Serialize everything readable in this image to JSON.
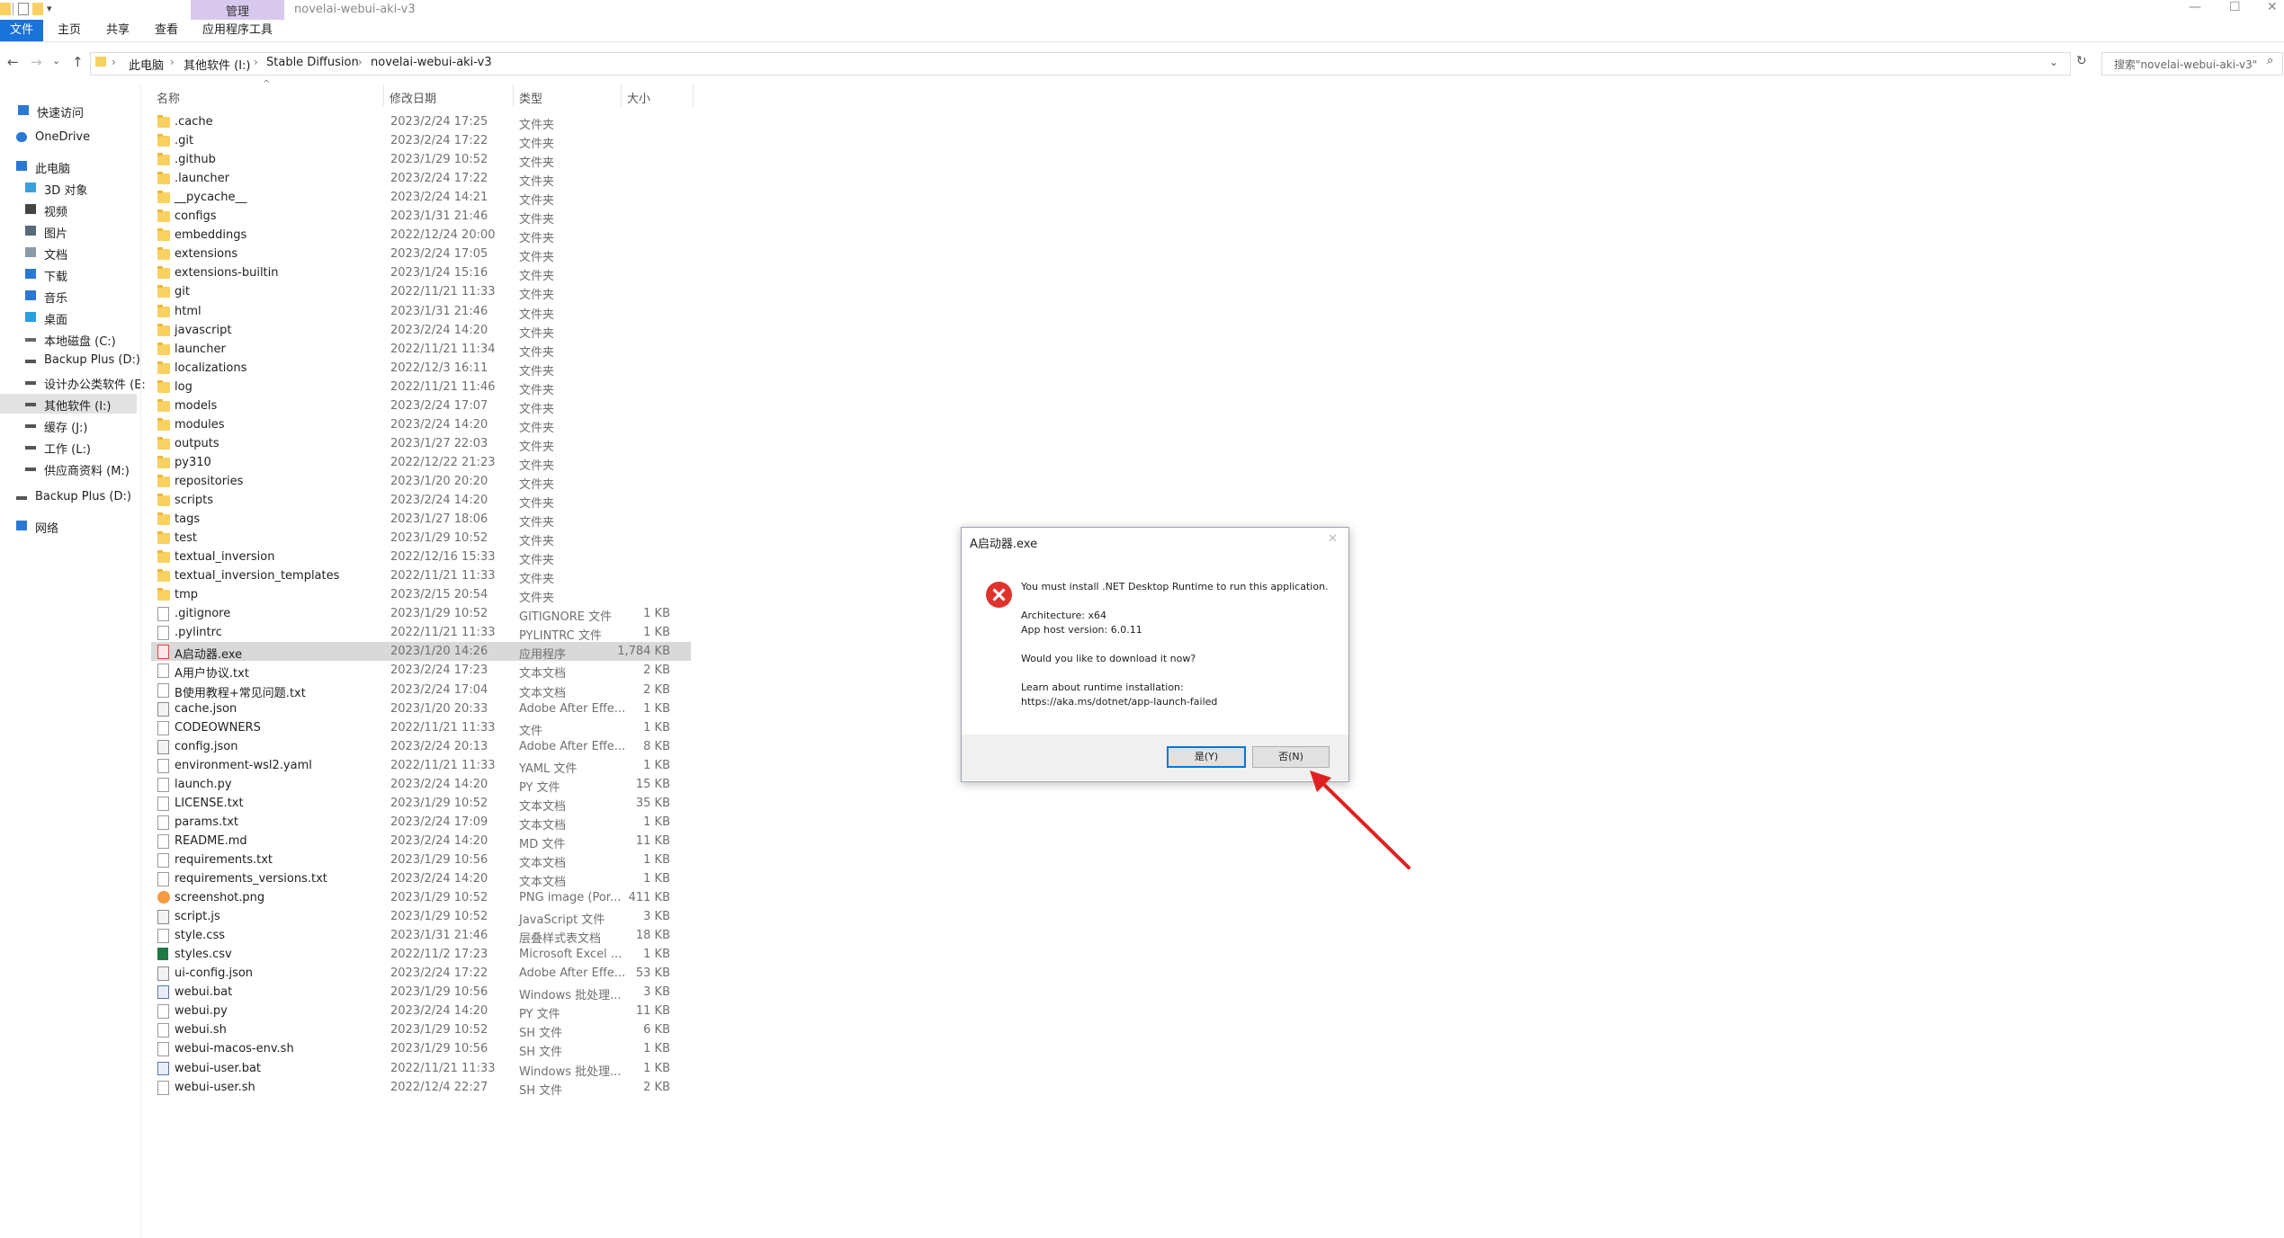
{
  "title_bar": {
    "manage_tab": "管理",
    "window_title": "novelai-webui-aki-v3",
    "minimize": "—",
    "maximize": "☐",
    "close": "✕"
  },
  "ribbon": {
    "tabs": [
      "文件",
      "主页",
      "共享",
      "查看",
      "应用程序工具"
    ]
  },
  "address": {
    "crumbs": [
      "此电脑",
      "其他软件 (I:)",
      "Stable Diffusion",
      "novelai-webui-aki-v3"
    ],
    "search_placeholder": "搜索\"novelai-webui-aki-v3\""
  },
  "sidebar": {
    "items": [
      {
        "label": "快速访问",
        "icon": "star-icon",
        "color": "#2b78d4"
      },
      {
        "label": "OneDrive",
        "icon": "cloud-icon",
        "color": "#2b78d4"
      },
      {
        "label": "此电脑",
        "icon": "computer-icon",
        "color": "#2b78d4"
      },
      {
        "label": "3D 对象",
        "icon": "cube-icon",
        "color": "#3aa0e0"
      },
      {
        "label": "视频",
        "icon": "video-icon",
        "color": "#444444"
      },
      {
        "label": "图片",
        "icon": "picture-icon",
        "color": "#5a6a7a"
      },
      {
        "label": "文档",
        "icon": "document-icon",
        "color": "#8a9aa8"
      },
      {
        "label": "下载",
        "icon": "download-icon",
        "color": "#2b78d4"
      },
      {
        "label": "音乐",
        "icon": "music-icon",
        "color": "#2b78d4"
      },
      {
        "label": "桌面",
        "icon": "desktop-icon",
        "color": "#2b9ee0"
      },
      {
        "label": "本地磁盘 (C:)",
        "icon": "drive-icon",
        "color": "#666666"
      },
      {
        "label": "Backup Plus (D:)",
        "icon": "drive-icon",
        "color": "#555555"
      },
      {
        "label": "设计办公类软件 (E:",
        "icon": "drive-icon",
        "color": "#555555"
      },
      {
        "label": "其他软件 (I:)",
        "icon": "drive-icon",
        "color": "#555555"
      },
      {
        "label": "缓存 (J:)",
        "icon": "drive-icon",
        "color": "#555555"
      },
      {
        "label": "工作 (L:)",
        "icon": "drive-icon",
        "color": "#555555"
      },
      {
        "label": "供应商资料 (M:)",
        "icon": "drive-icon",
        "color": "#555555"
      },
      {
        "label": "Backup Plus (D:)",
        "icon": "drive-icon",
        "color": "#555555"
      },
      {
        "label": "网络",
        "icon": "network-icon",
        "color": "#2b78d4"
      }
    ]
  },
  "columns": [
    "名称",
    "修改日期",
    "类型",
    "大小"
  ],
  "files": [
    {
      "name": ".cache",
      "date": "2023/2/24 17:25",
      "type": "文件夹",
      "size": "",
      "icon": "folder"
    },
    {
      "name": ".git",
      "date": "2023/2/24 17:22",
      "type": "文件夹",
      "size": "",
      "icon": "folder"
    },
    {
      "name": ".github",
      "date": "2023/1/29 10:52",
      "type": "文件夹",
      "size": "",
      "icon": "folder"
    },
    {
      "name": ".launcher",
      "date": "2023/2/24 17:22",
      "type": "文件夹",
      "size": "",
      "icon": "folder"
    },
    {
      "name": "__pycache__",
      "date": "2023/2/24 14:21",
      "type": "文件夹",
      "size": "",
      "icon": "folder"
    },
    {
      "name": "configs",
      "date": "2023/1/31 21:46",
      "type": "文件夹",
      "size": "",
      "icon": "folder"
    },
    {
      "name": "embeddings",
      "date": "2022/12/24 20:00",
      "type": "文件夹",
      "size": "",
      "icon": "folder"
    },
    {
      "name": "extensions",
      "date": "2023/2/24 17:05",
      "type": "文件夹",
      "size": "",
      "icon": "folder"
    },
    {
      "name": "extensions-builtin",
      "date": "2023/1/24 15:16",
      "type": "文件夹",
      "size": "",
      "icon": "folder"
    },
    {
      "name": "git",
      "date": "2022/11/21 11:33",
      "type": "文件夹",
      "size": "",
      "icon": "folder"
    },
    {
      "name": "html",
      "date": "2023/1/31 21:46",
      "type": "文件夹",
      "size": "",
      "icon": "folder"
    },
    {
      "name": "javascript",
      "date": "2023/2/24 14:20",
      "type": "文件夹",
      "size": "",
      "icon": "folder"
    },
    {
      "name": "launcher",
      "date": "2022/11/21 11:34",
      "type": "文件夹",
      "size": "",
      "icon": "folder"
    },
    {
      "name": "localizations",
      "date": "2022/12/3 16:11",
      "type": "文件夹",
      "size": "",
      "icon": "folder"
    },
    {
      "name": "log",
      "date": "2022/11/21 11:46",
      "type": "文件夹",
      "size": "",
      "icon": "folder"
    },
    {
      "name": "models",
      "date": "2023/2/24 17:07",
      "type": "文件夹",
      "size": "",
      "icon": "folder"
    },
    {
      "name": "modules",
      "date": "2023/2/24 14:20",
      "type": "文件夹",
      "size": "",
      "icon": "folder"
    },
    {
      "name": "outputs",
      "date": "2023/1/27 22:03",
      "type": "文件夹",
      "size": "",
      "icon": "folder"
    },
    {
      "name": "py310",
      "date": "2022/12/22 21:23",
      "type": "文件夹",
      "size": "",
      "icon": "folder"
    },
    {
      "name": "repositories",
      "date": "2023/1/20 20:20",
      "type": "文件夹",
      "size": "",
      "icon": "folder"
    },
    {
      "name": "scripts",
      "date": "2023/2/24 14:20",
      "type": "文件夹",
      "size": "",
      "icon": "folder"
    },
    {
      "name": "tags",
      "date": "2023/1/27 18:06",
      "type": "文件夹",
      "size": "",
      "icon": "folder"
    },
    {
      "name": "test",
      "date": "2023/1/29 10:52",
      "type": "文件夹",
      "size": "",
      "icon": "folder"
    },
    {
      "name": "textual_inversion",
      "date": "2022/12/16 15:33",
      "type": "文件夹",
      "size": "",
      "icon": "folder"
    },
    {
      "name": "textual_inversion_templates",
      "date": "2022/11/21 11:33",
      "type": "文件夹",
      "size": "",
      "icon": "folder"
    },
    {
      "name": "tmp",
      "date": "2023/2/15 20:54",
      "type": "文件夹",
      "size": "",
      "icon": "folder"
    },
    {
      "name": ".gitignore",
      "date": "2023/1/29 10:52",
      "type": "GITIGNORE 文件",
      "size": "1 KB",
      "icon": "doc"
    },
    {
      "name": ".pylintrc",
      "date": "2022/11/21 11:33",
      "type": "PYLINTRC 文件",
      "size": "1 KB",
      "icon": "doc"
    },
    {
      "name": "A启动器.exe",
      "date": "2023/1/20 14:26",
      "type": "应用程序",
      "size": "1,784 KB",
      "icon": "exe",
      "selected": true
    },
    {
      "name": "A用户协议.txt",
      "date": "2023/2/24 17:23",
      "type": "文本文档",
      "size": "2 KB",
      "icon": "doc"
    },
    {
      "name": "B使用教程+常见问题.txt",
      "date": "2023/2/24 17:04",
      "type": "文本文档",
      "size": "2 KB",
      "icon": "doc"
    },
    {
      "name": "cache.json",
      "date": "2023/1/20 20:33",
      "type": "Adobe After Effe...",
      "size": "1 KB",
      "icon": "doc-code"
    },
    {
      "name": "CODEOWNERS",
      "date": "2022/11/21 11:33",
      "type": "文件",
      "size": "1 KB",
      "icon": "doc"
    },
    {
      "name": "config.json",
      "date": "2023/2/24 20:13",
      "type": "Adobe After Effe...",
      "size": "8 KB",
      "icon": "doc-code"
    },
    {
      "name": "environment-wsl2.yaml",
      "date": "2022/11/21 11:33",
      "type": "YAML 文件",
      "size": "1 KB",
      "icon": "doc"
    },
    {
      "name": "launch.py",
      "date": "2023/2/24 14:20",
      "type": "PY 文件",
      "size": "15 KB",
      "icon": "doc"
    },
    {
      "name": "LICENSE.txt",
      "date": "2023/1/29 10:52",
      "type": "文本文档",
      "size": "35 KB",
      "icon": "doc"
    },
    {
      "name": "params.txt",
      "date": "2023/2/24 17:09",
      "type": "文本文档",
      "size": "1 KB",
      "icon": "doc"
    },
    {
      "name": "README.md",
      "date": "2023/2/24 14:20",
      "type": "MD 文件",
      "size": "11 KB",
      "icon": "doc"
    },
    {
      "name": "requirements.txt",
      "date": "2023/1/29 10:56",
      "type": "文本文档",
      "size": "1 KB",
      "icon": "doc"
    },
    {
      "name": "requirements_versions.txt",
      "date": "2023/2/24 14:20",
      "type": "文本文档",
      "size": "1 KB",
      "icon": "doc"
    },
    {
      "name": "screenshot.png",
      "date": "2023/1/29 10:52",
      "type": "PNG image (Por...",
      "size": "411 KB",
      "icon": "img"
    },
    {
      "name": "script.js",
      "date": "2023/1/29 10:52",
      "type": "JavaScript 文件",
      "size": "3 KB",
      "icon": "doc-code"
    },
    {
      "name": "style.css",
      "date": "2023/1/31 21:46",
      "type": "层叠样式表文档",
      "size": "18 KB",
      "icon": "doc"
    },
    {
      "name": "styles.csv",
      "date": "2022/11/2 17:23",
      "type": "Microsoft Excel ...",
      "size": "1 KB",
      "icon": "csv"
    },
    {
      "name": "ui-config.json",
      "date": "2023/2/24 17:22",
      "type": "Adobe After Effe...",
      "size": "53 KB",
      "icon": "doc-code"
    },
    {
      "name": "webui.bat",
      "date": "2023/1/29 10:56",
      "type": "Windows 批处理...",
      "size": "3 KB",
      "icon": "bat"
    },
    {
      "name": "webui.py",
      "date": "2023/2/24 14:20",
      "type": "PY 文件",
      "size": "11 KB",
      "icon": "doc"
    },
    {
      "name": "webui.sh",
      "date": "2023/1/29 10:52",
      "type": "SH 文件",
      "size": "6 KB",
      "icon": "doc"
    },
    {
      "name": "webui-macos-env.sh",
      "date": "2023/1/29 10:56",
      "type": "SH 文件",
      "size": "1 KB",
      "icon": "doc"
    },
    {
      "name": "webui-user.bat",
      "date": "2022/11/21 11:33",
      "type": "Windows 批处理...",
      "size": "1 KB",
      "icon": "bat"
    },
    {
      "name": "webui-user.sh",
      "date": "2022/12/4 22:27",
      "type": "SH 文件",
      "size": "2 KB",
      "icon": "doc"
    }
  ],
  "dialog": {
    "title": "A启动器.exe",
    "close": "✕",
    "message": "You must install .NET Desktop Runtime to run this application.",
    "arch": "Architecture: x64",
    "host_version": "App host version: 6.0.11",
    "question": "Would you like to download it now?",
    "learn": "Learn about runtime installation:",
    "link": "https://aka.ms/dotnet/app-launch-failed",
    "yes_label": "是(Y)",
    "no_label": "否(N)"
  },
  "colors": {
    "accent": "#1a73d9",
    "manage_tab": "#d9c8ee",
    "error": "#e0322c",
    "annotation_arrow": "#e02020"
  }
}
